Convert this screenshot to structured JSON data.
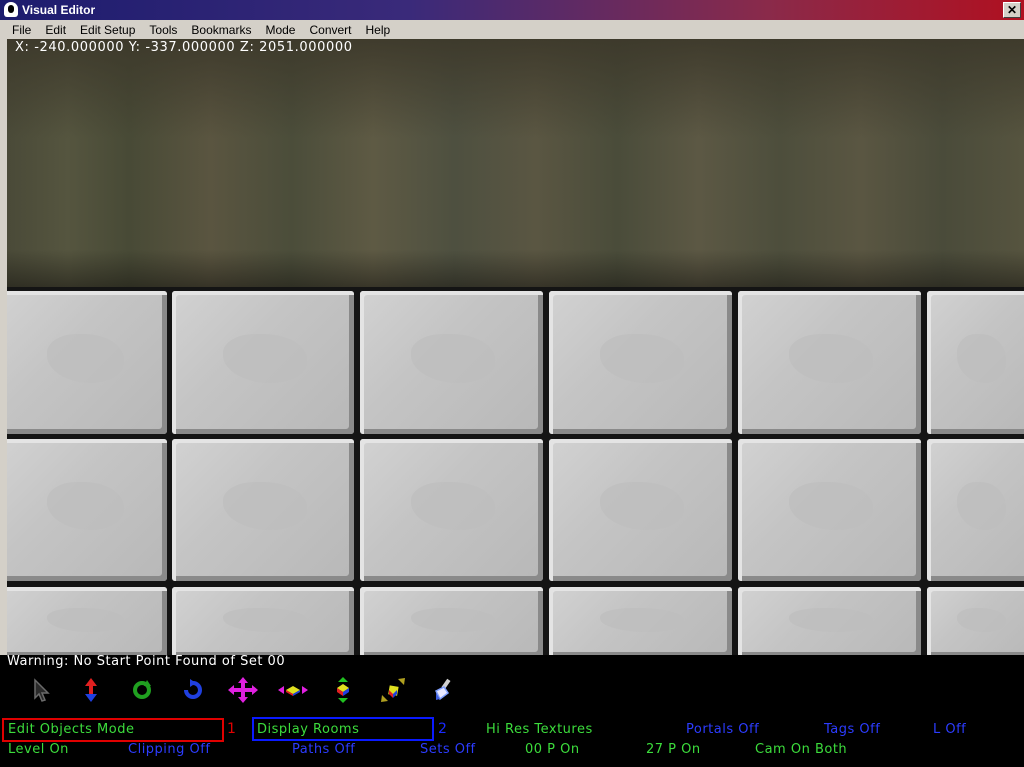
{
  "window": {
    "title": "Visual Editor",
    "close_glyph": "✕"
  },
  "menu": [
    "File",
    "Edit",
    "Edit Setup",
    "Tools",
    "Bookmarks",
    "Mode",
    "Convert",
    "Help"
  ],
  "viewport": {
    "coords": "X: -240.000000 Y: -337.000000 Z: 2051.000000"
  },
  "warning": "Warning: No Start Point Found of Set 00",
  "toolbar_icons": [
    {
      "name": "select-arrow-icon",
      "color": "#5a5a5a"
    },
    {
      "name": "move-vertical-icon",
      "color": "#e02020"
    },
    {
      "name": "rotate-green-icon",
      "color": "#20a020"
    },
    {
      "name": "rotate-blue-icon",
      "color": "#2040e0"
    },
    {
      "name": "move-cross-icon",
      "color": "#e020e0"
    },
    {
      "name": "scale-cube-icon",
      "color": "#e0e020"
    },
    {
      "name": "axis-cube-icon",
      "color": "#20c020"
    },
    {
      "name": "stretch-cube-icon",
      "color": "#b0a020"
    },
    {
      "name": "paint-brush-icon",
      "color": "#80a0ff"
    }
  ],
  "status_row1": [
    {
      "text": "Edit Objects Mode",
      "color": "green"
    },
    {
      "text": "Display Rooms",
      "color": "green"
    },
    {
      "text": "Hi Res Textures",
      "color": "green"
    },
    {
      "text": "Portals Off",
      "color": "blue"
    },
    {
      "text": "Tags Off",
      "color": "blue"
    },
    {
      "text": "L Off",
      "color": "blue"
    }
  ],
  "status_row2": [
    {
      "text": "Level On",
      "color": "green"
    },
    {
      "text": "Clipping Off",
      "color": "blue"
    },
    {
      "text": "Paths Off",
      "color": "blue"
    },
    {
      "text": "Sets Off",
      "color": "blue"
    },
    {
      "text": "00 P On",
      "color": "green"
    },
    {
      "text": "27 P On",
      "color": "green"
    },
    {
      "text": "Cam On Both",
      "color": "green"
    }
  ],
  "annotations": {
    "label1": "1",
    "label2": "2"
  }
}
